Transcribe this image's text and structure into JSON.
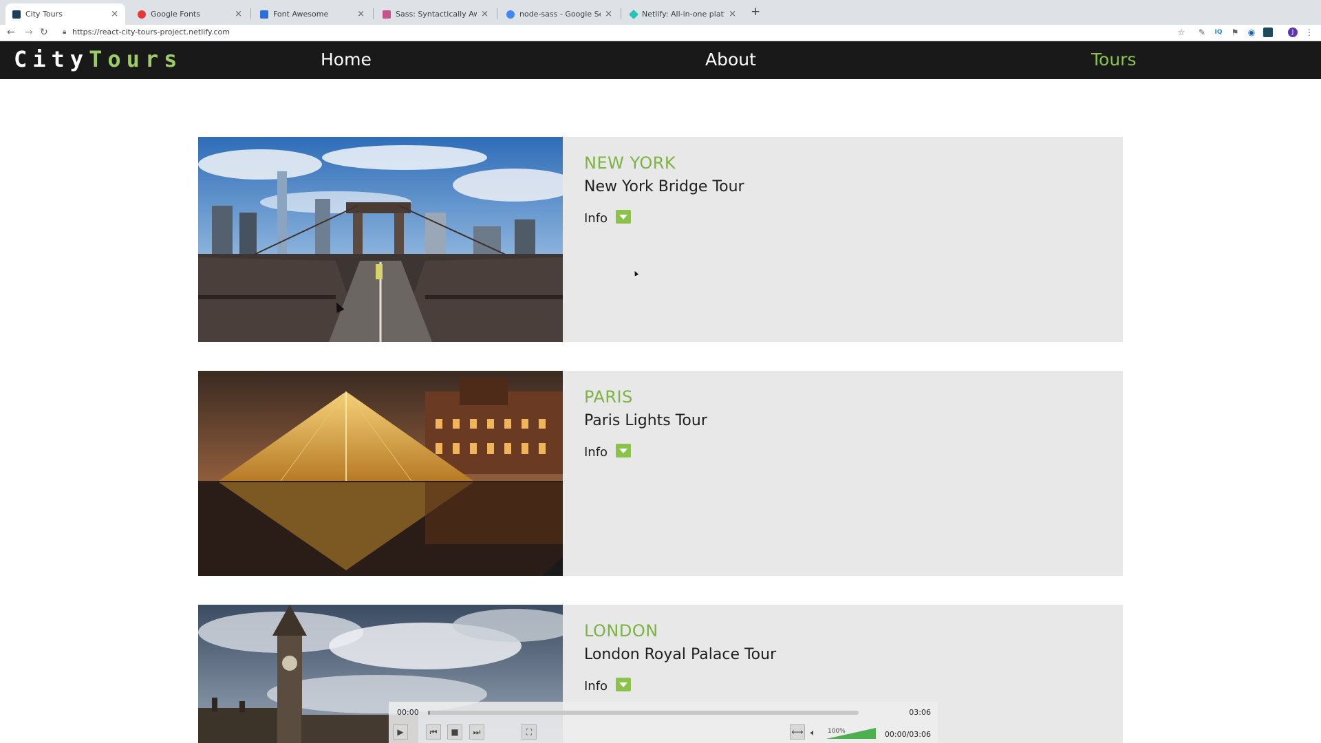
{
  "browser": {
    "tabs": [
      {
        "title": "City Tours",
        "color": "#1c3f5e"
      },
      {
        "title": "Google Fonts",
        "color": "#e53935"
      },
      {
        "title": "Font Awesome",
        "color": "#2a6fdb"
      },
      {
        "title": "Sass: Syntactically Awesome S",
        "color": "#c6538c"
      },
      {
        "title": "node-sass - Google Search",
        "color": "#4285f4"
      },
      {
        "title": "Netlify: All-in-one platform for",
        "color": "#20c6b7"
      }
    ],
    "url": "https://react-city-tours-project.netlify.com"
  },
  "site": {
    "logo_city": "City",
    "logo_tours": "Tours",
    "nav": {
      "home": "Home",
      "about": "About",
      "tours": "Tours"
    },
    "accent": "#8bc34a"
  },
  "tours": [
    {
      "city": "NEW YORK",
      "name": "New York Bridge Tour",
      "info": "Info"
    },
    {
      "city": "PARIS",
      "name": "Paris Lights Tour",
      "info": "Info"
    },
    {
      "city": "LONDON",
      "name": "London Royal Palace Tour",
      "info": "Info"
    }
  ],
  "player": {
    "current": "00:00",
    "duration": "03:06",
    "volume": "100%",
    "time_total": "00:00/03:06",
    "progress": 0.0
  }
}
